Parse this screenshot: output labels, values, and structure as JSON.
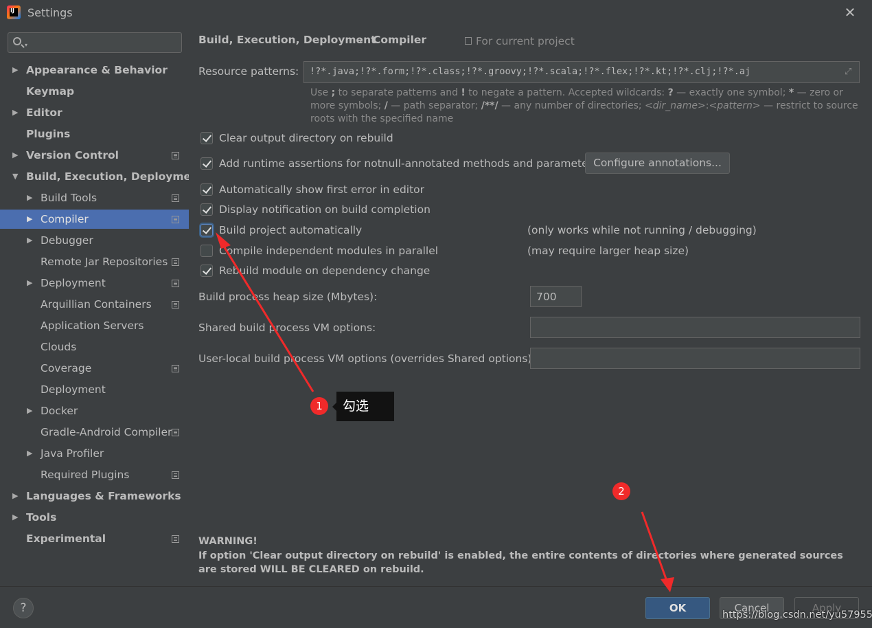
{
  "window": {
    "title": "Settings",
    "app_icon_text": "IJ"
  },
  "sidebar": {
    "search_placeholder": "",
    "items": [
      {
        "label": "Appearance & Behavior",
        "level": 0,
        "arrow": "▶",
        "bold": true
      },
      {
        "label": "Keymap",
        "level": 0,
        "bold": true
      },
      {
        "label": "Editor",
        "level": 0,
        "arrow": "▶",
        "bold": true
      },
      {
        "label": "Plugins",
        "level": 0,
        "bold": true
      },
      {
        "label": "Version Control",
        "level": 0,
        "arrow": "▶",
        "bold": true,
        "project": true
      },
      {
        "label": "Build, Execution, Deployment",
        "level": 0,
        "arrow": "▼",
        "bold": true
      },
      {
        "label": "Build Tools",
        "level": 1,
        "arrow": "▶",
        "project": true
      },
      {
        "label": "Compiler",
        "level": 1,
        "arrow": "▶",
        "project": true,
        "selected": true
      },
      {
        "label": "Debugger",
        "level": 1,
        "arrow": "▶"
      },
      {
        "label": "Remote Jar Repositories",
        "level": 1,
        "project": true
      },
      {
        "label": "Deployment",
        "level": 1,
        "arrow": "▶",
        "project": true
      },
      {
        "label": "Arquillian Containers",
        "level": 1,
        "project": true
      },
      {
        "label": "Application Servers",
        "level": 1
      },
      {
        "label": "Clouds",
        "level": 1
      },
      {
        "label": "Coverage",
        "level": 1,
        "project": true
      },
      {
        "label": "Deployment",
        "level": 1
      },
      {
        "label": "Docker",
        "level": 1,
        "arrow": "▶"
      },
      {
        "label": "Gradle-Android Compiler",
        "level": 1,
        "project": true
      },
      {
        "label": "Java Profiler",
        "level": 1,
        "arrow": "▶"
      },
      {
        "label": "Required Plugins",
        "level": 1,
        "project": true
      },
      {
        "label": "Languages & Frameworks",
        "level": 0,
        "arrow": "▶",
        "bold": true
      },
      {
        "label": "Tools",
        "level": 0,
        "arrow": "▶",
        "bold": true
      },
      {
        "label": "Experimental",
        "level": 0,
        "bold": true,
        "project": true
      }
    ]
  },
  "main": {
    "breadcrumb": {
      "parent": "Build, Execution, Deployment",
      "separator": "›",
      "current": "Compiler"
    },
    "scope": "For current project",
    "resource_patterns": {
      "label": "Resource patterns:",
      "value": "!?*.java;!?*.form;!?*.class;!?*.groovy;!?*.scala;!?*.flex;!?*.kt;!?*.clj;!?*.aj",
      "hint": {
        "t1": "Use ",
        "b1": ";",
        "t2": " to separate patterns and ",
        "b2": "!",
        "t3": " to negate a pattern. Accepted wildcards: ",
        "b3": "?",
        "t4": " — exactly one symbol; ",
        "b4": "*",
        "t5": " — zero or more symbols; ",
        "b5": "/",
        "t6": " — path separator; ",
        "b6": "/**/",
        "t7": " — any number of directories; ",
        "i1": "<dir_name>",
        "t8": ":",
        "i2": "<pattern>",
        "t9": " — restrict to source roots with the specified name"
      }
    },
    "checkboxes": [
      {
        "label": "Clear output directory on rebuild",
        "checked": true
      },
      {
        "label": "Add runtime assertions for notnull-annotated methods and parameters",
        "checked": true
      },
      {
        "label": "Automatically show first error in editor",
        "checked": true
      },
      {
        "label": "Display notification on build completion",
        "checked": true
      },
      {
        "label": "Build project automatically",
        "checked": true,
        "note": "(only works while not running / debugging)"
      },
      {
        "label": "Compile independent modules in parallel",
        "checked": false,
        "note": "(may require larger heap size)"
      },
      {
        "label": "Rebuild module on dependency change",
        "checked": true
      }
    ],
    "configure_button": "Configure annotations...",
    "heap": {
      "label": "Build process heap size (Mbytes):",
      "value": "700"
    },
    "shared_vm": {
      "label": "Shared build process VM options:",
      "value": ""
    },
    "user_vm": {
      "label": "User-local build process VM options (overrides Shared options):",
      "value": ""
    },
    "warning": {
      "title": "WARNING!",
      "body": "If option 'Clear output directory on rebuild' is enabled, the entire contents of directories where generated sources are stored WILL BE CLEARED on rebuild."
    }
  },
  "footer": {
    "help": "?",
    "ok": "OK",
    "cancel": "Cancel",
    "apply": "Apply"
  },
  "annotations": {
    "badge1": "1",
    "tip1": "勾选",
    "badge2": "2",
    "watermark": "https://blog.csdn.net/yu57955",
    "color": "#f02a2a"
  }
}
